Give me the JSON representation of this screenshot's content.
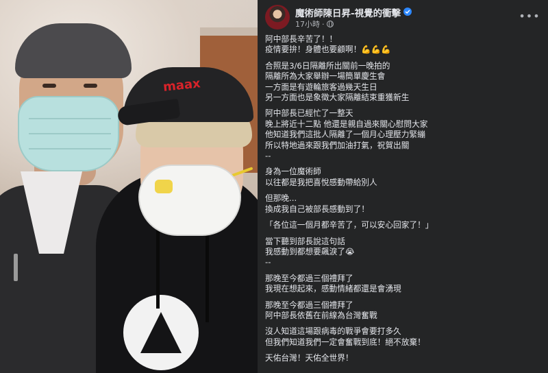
{
  "post": {
    "author": "魔術師陳日昇-視覺的衝擊",
    "time": "17小時",
    "more_icon": "more-horizontal-icon",
    "privacy_icon": "globe-icon",
    "paragraphs": [
      [
        "阿中部長辛苦了！！",
        "疫情要拚！身體也要顧啊！💪💪💪"
      ],
      [
        "合照是3/6日隔離所出關前一晚拍的",
        "隔離所為大家舉辦一場簡單慶生會",
        "一方面是有遊輪旅客過幾天生日",
        "另一方面也是象徵大家隔離結束重獲新生"
      ],
      [
        "阿中部長已經忙了一整天",
        "晚上將近十二點 他還是親自過來關心慰問大家",
        "他知道我們這批人隔離了一個月心理壓力緊繃",
        "所以特地過來跟我們加油打氣，祝賀出關",
        "--"
      ],
      [
        "身為一位魔術師",
        "以往都是我把喜悅感動帶給別人"
      ],
      [
        "但那晚...",
        "換成我自己被部長感動到了！"
      ],
      [
        "「各位這一個月都辛苦了，可以安心回家了！」"
      ],
      [
        "當下聽到部長說這句話",
        "我感動到都想要飆淚了😭",
        "--"
      ],
      [
        "那晚至今都過三個禮拜了",
        "我現在想起來，感動情緒都還是會湧現"
      ],
      [
        "那晚至今都過三個禮拜了",
        "阿中部長依舊在前線為台灣奮戰"
      ],
      [
        "沒人知道這場跟病毒的戰爭會要打多久",
        "但我們知道我們一定會奮戰到底！絕不放棄！"
      ],
      [
        "天佑台灣！天佑全世界！"
      ]
    ]
  },
  "photo": {
    "cap_text": "maax"
  }
}
